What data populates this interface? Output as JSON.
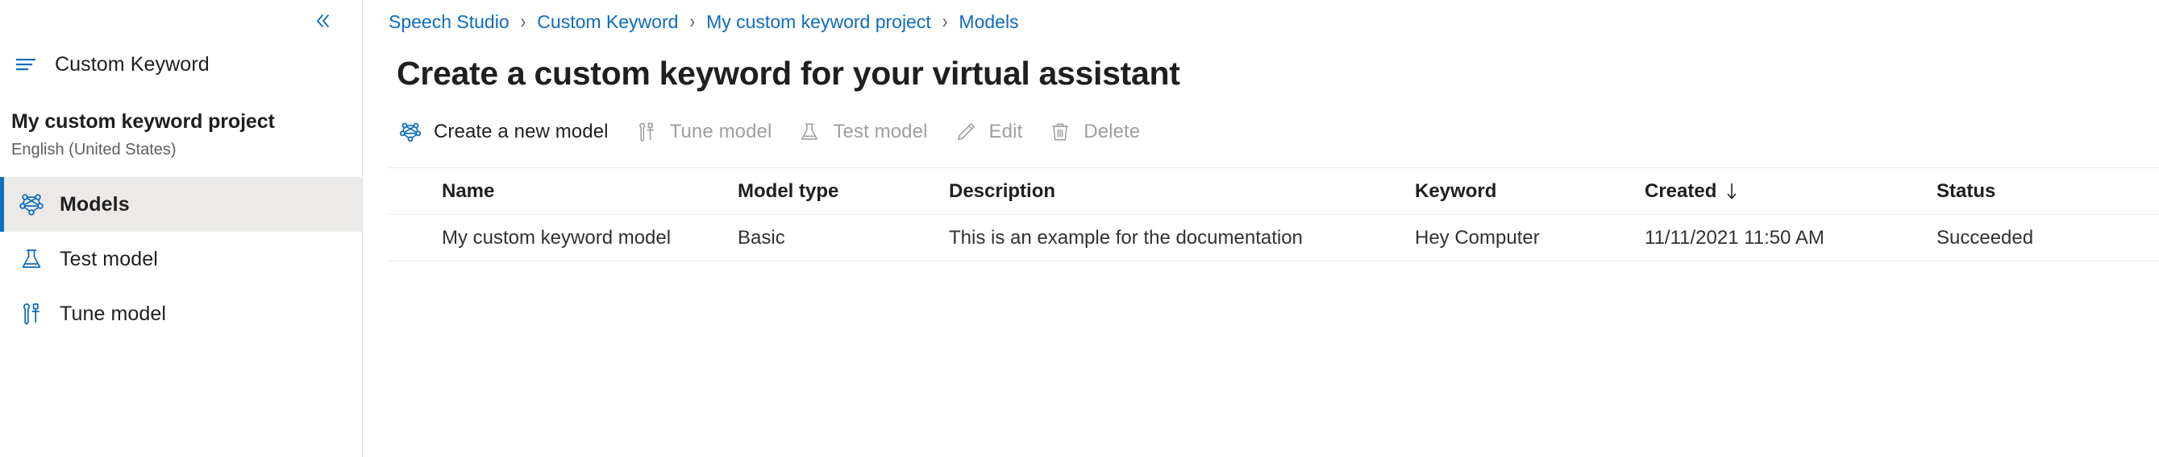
{
  "sidebar": {
    "collapse_icon": "chevron-double-left-icon",
    "brand": {
      "icon": "hamburger-menu-icon",
      "label": "Custom Keyword"
    },
    "project": {
      "name": "My custom keyword project",
      "locale": "English (United States)"
    },
    "items": [
      {
        "label": "Models",
        "icon": "network-graph-icon",
        "active": true
      },
      {
        "label": "Test model",
        "icon": "flask-icon",
        "active": false
      },
      {
        "label": "Tune model",
        "icon": "tools-icon",
        "active": false
      }
    ]
  },
  "breadcrumb": {
    "separator": "›",
    "items": [
      {
        "label": "Speech Studio"
      },
      {
        "label": "Custom Keyword"
      },
      {
        "label": "My custom keyword project"
      },
      {
        "label": "Models"
      }
    ]
  },
  "page": {
    "title": "Create a custom keyword for your virtual assistant"
  },
  "toolbar": {
    "buttons": [
      {
        "label": "Create a new model",
        "icon": "network-graph-icon",
        "disabled": false
      },
      {
        "label": "Tune model",
        "icon": "tools-icon",
        "disabled": true
      },
      {
        "label": "Test model",
        "icon": "flask-icon",
        "disabled": true
      },
      {
        "label": "Edit",
        "icon": "pencil-icon",
        "disabled": true
      },
      {
        "label": "Delete",
        "icon": "trash-icon",
        "disabled": true
      }
    ]
  },
  "table": {
    "columns": [
      {
        "key": "name",
        "label": "Name",
        "sorted": false
      },
      {
        "key": "type",
        "label": "Model type",
        "sorted": false
      },
      {
        "key": "desc",
        "label": "Description",
        "sorted": false
      },
      {
        "key": "keyword",
        "label": "Keyword",
        "sorted": false
      },
      {
        "key": "created",
        "label": "Created",
        "sorted": true,
        "sort_dir": "desc",
        "sort_icon": "arrow-down-icon"
      },
      {
        "key": "status",
        "label": "Status",
        "sorted": false
      }
    ],
    "rows": [
      {
        "name": "My custom keyword model",
        "type": "Basic",
        "desc": "This is an example for the documentation",
        "keyword": "Hey Computer",
        "created": "11/11/2021 11:50 AM",
        "status": "Succeeded"
      }
    ]
  },
  "colors": {
    "link": "#0f6cbd",
    "accent": "#0f6cbd",
    "success": "#107c10",
    "disabled": "#a19f9d",
    "text": "#201f1e",
    "row_highlight": "#ebeae9",
    "divider": "#edebe9"
  }
}
